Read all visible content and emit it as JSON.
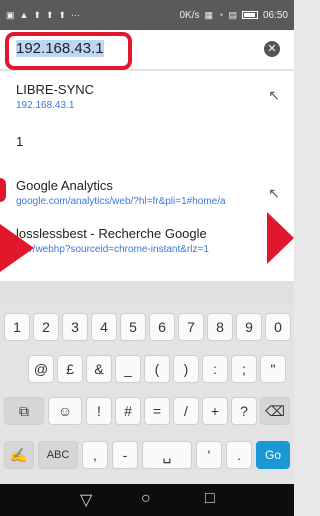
{
  "status_bar": {
    "left_icons": [
      "app-icon",
      "app-icon",
      "app-icon",
      "app-icon",
      "app-icon",
      "more-icon"
    ],
    "speed": "0K/s",
    "time": "06:50"
  },
  "url_bar": {
    "value": "192.168.43.1",
    "clear_icon": "clear-icon"
  },
  "suggestions": [
    {
      "title": "LIBRE-SYNC",
      "url": "192.168.43.1"
    },
    {
      "title": "1",
      "url": ""
    },
    {
      "title": "Google Analytics",
      "url": "google.com/analytics/web/?hl=fr&pli=1#home/a"
    },
    {
      "title": "losslessbest - Recherche Google",
      "url": "le.fr/webhp?sourceid=chrome-instant&rlz=1"
    }
  ],
  "keyboard": {
    "row1": [
      "1",
      "2",
      "3",
      "4",
      "5",
      "6",
      "7",
      "8",
      "9",
      "0"
    ],
    "row2": [
      "@",
      "£",
      "&",
      "_",
      "(",
      ")",
      ":",
      ";",
      "\""
    ],
    "row3": [
      "!",
      "#",
      "=",
      "/",
      "+",
      "?"
    ],
    "row4_abc": "ABC",
    "row4_keys": [
      ",",
      "-",
      "'",
      "."
    ],
    "go": "Go"
  },
  "accent_color": "#e1182b",
  "link_color": "#3b78d8"
}
